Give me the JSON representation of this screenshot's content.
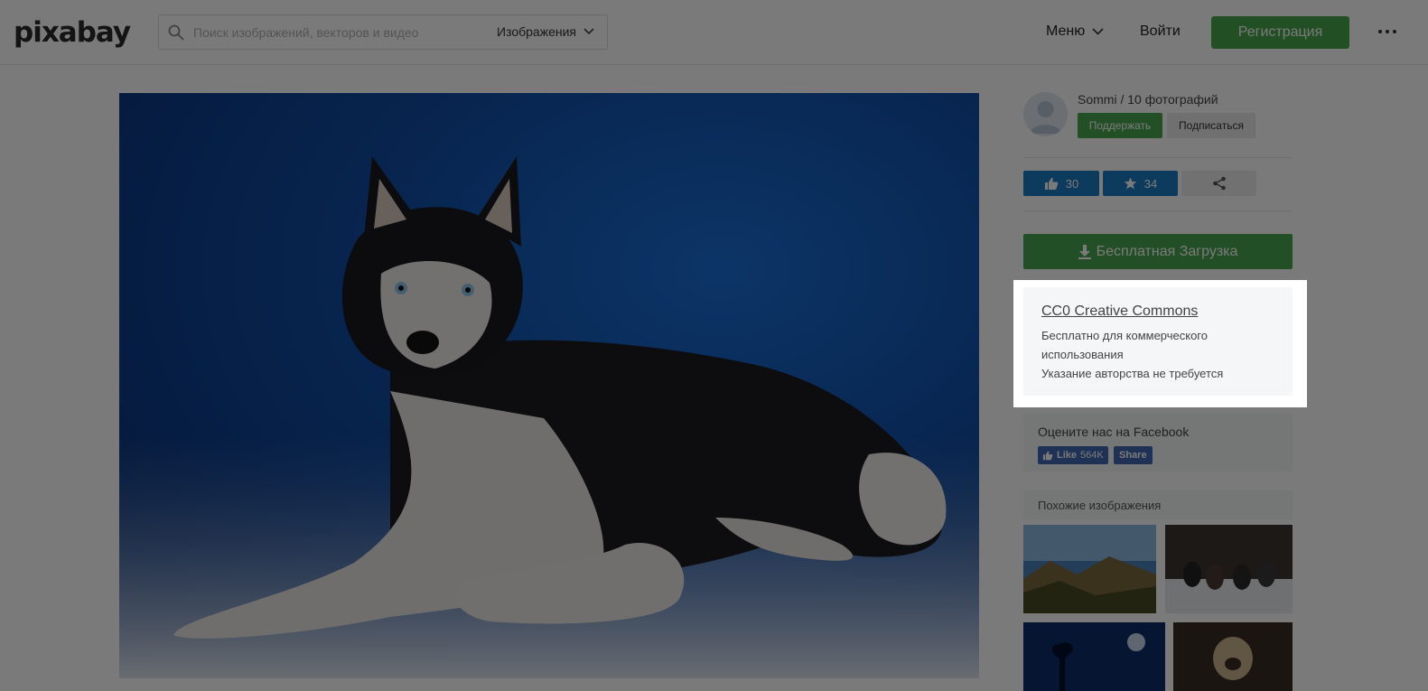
{
  "header": {
    "logo": "pixabay",
    "search_placeholder": "Поиск изображений, векторов и видео",
    "type_select": "Изображения",
    "menu_label": "Меню",
    "login_label": "Войти",
    "register_label": "Регистрация"
  },
  "author": {
    "name": "Sommi / 10 фотографий",
    "support_label": "Поддержать",
    "follow_label": "Подписаться"
  },
  "stats": {
    "likes": "30",
    "favorites": "34"
  },
  "download_label": "Бесплатная Загрузка",
  "license": {
    "title": "CC0 Creative Commons",
    "line1": "Бесплатно для коммерческого",
    "line2": "использования",
    "line3": "Указание авторства не требуется"
  },
  "facebook": {
    "title": "Оцените нас на Facebook",
    "like_label": "Like",
    "like_count": "564K",
    "share_label": "Share"
  },
  "similar": {
    "title": "Похожие изображения"
  },
  "colors": {
    "green": "#4aa650",
    "blue": "#1a7cc4",
    "overlay": "rgba(0,0,0,0.52)"
  }
}
